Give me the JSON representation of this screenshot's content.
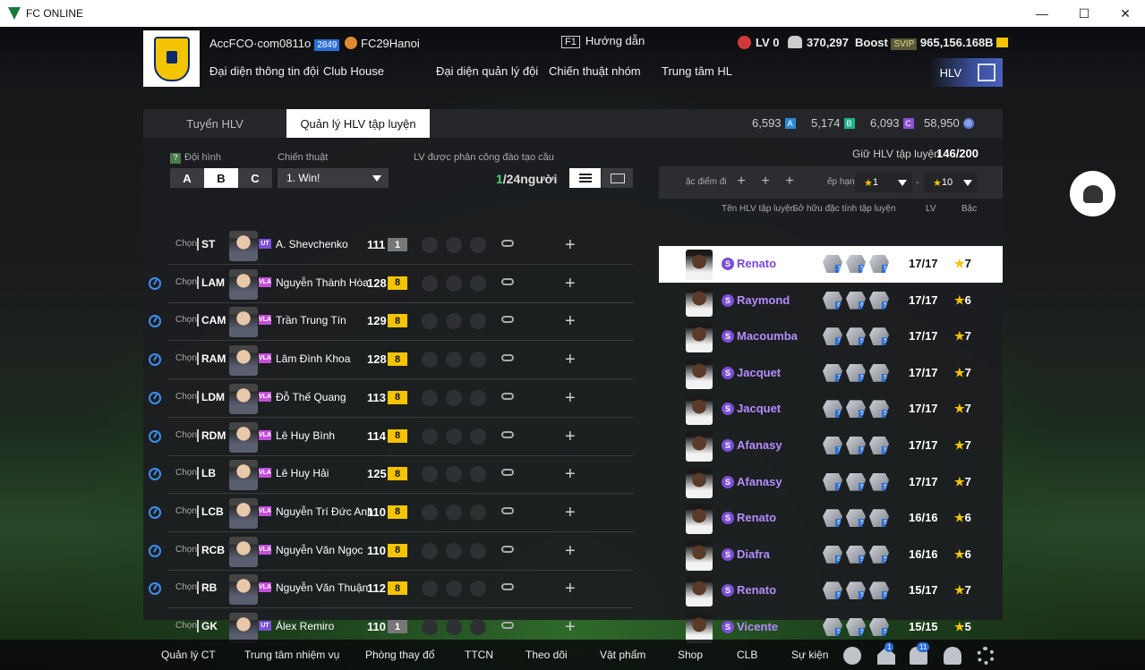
{
  "window": {
    "title": "FC ONLINE",
    "min": "—",
    "max": "☐",
    "close": "✕"
  },
  "header": {
    "account": "AccFCO·com0811o",
    "ovr": "2849",
    "club": "FC29Hanoi",
    "guide_key": "F1",
    "guide": "Hướng dẫn",
    "lv": "LV 0",
    "points": "370,297",
    "boost": "Boost",
    "svip": "SVIP",
    "bp": "965,156.168B",
    "nav": [
      "Đại diện thông tin đội",
      "Club House",
      "Đại diện quản lý đội",
      "Chiến thuật nhóm",
      "Trung tâm HL"
    ],
    "hlv": "HLV"
  },
  "tabs": [
    "Tuyển HLV",
    "Quản lý HLV tập luyện"
  ],
  "currencies": [
    {
      "v": "6,593",
      "g": "A",
      "c": "#2a8ad6"
    },
    {
      "v": "5,174",
      "g": "B",
      "c": "#1fb08a"
    },
    {
      "v": "6,093",
      "g": "C",
      "c": "#8a4fd8"
    },
    {
      "v": "58,950",
      "g": "◎",
      "c": "#5a7ad8"
    }
  ],
  "left": {
    "formation_label": "Đội hình",
    "formation_help": "?",
    "formations": [
      "A",
      "B",
      "C"
    ],
    "selected_formation": "B",
    "tactic_label": "Chiến thuật",
    "tactic_value": "1. Win!",
    "assign_label": "LV được phân công đào tạo cầu thủ",
    "assigned": "1",
    "assign_total": "/24người",
    "players": [
      {
        "pos": "ST",
        "season": "UT",
        "sc": "#7b4fd8",
        "name": "A. Shevchenko",
        "ovr": "111",
        "lvl": "1",
        "timer": false
      },
      {
        "pos": "LAM",
        "season": "VLA",
        "sc": "#c24fd8",
        "name": "Nguyễn Thành Hòa",
        "ovr": "128",
        "lvl": "8",
        "timer": true
      },
      {
        "pos": "CAM",
        "season": "VLA",
        "sc": "#c24fd8",
        "name": "Trần Trung Tín",
        "ovr": "129",
        "lvl": "8",
        "timer": true
      },
      {
        "pos": "RAM",
        "season": "VLA",
        "sc": "#c24fd8",
        "name": "Lâm Đình Khoa",
        "ovr": "128",
        "lvl": "8",
        "timer": true
      },
      {
        "pos": "LDM",
        "season": "VLA",
        "sc": "#c24fd8",
        "name": "Đỗ Thế Quang",
        "ovr": "113",
        "lvl": "8",
        "timer": true
      },
      {
        "pos": "RDM",
        "season": "VLA",
        "sc": "#c24fd8",
        "name": "Lê Huy Bình",
        "ovr": "114",
        "lvl": "8",
        "timer": true
      },
      {
        "pos": "LB",
        "season": "VLA",
        "sc": "#c24fd8",
        "name": "Lê Huy Hải",
        "ovr": "125",
        "lvl": "8",
        "timer": true
      },
      {
        "pos": "LCB",
        "season": "VLA",
        "sc": "#c24fd8",
        "name": "Nguyễn Trí Đức Anh",
        "ovr": "110",
        "lvl": "8",
        "timer": true
      },
      {
        "pos": "RCB",
        "season": "VLA",
        "sc": "#c24fd8",
        "name": "Nguyễn Văn Ngọc",
        "ovr": "110",
        "lvl": "8",
        "timer": true
      },
      {
        "pos": "RB",
        "season": "VLA",
        "sc": "#c24fd8",
        "name": "Nguyễn Văn Thuận",
        "ovr": "112",
        "lvl": "8",
        "timer": true
      },
      {
        "pos": "GK",
        "season": "UT",
        "sc": "#7b4fd8",
        "name": "Álex Remiro",
        "ovr": "110",
        "lvl": "1",
        "timer": false
      }
    ],
    "chon": "Chọn"
  },
  "right": {
    "keep_label": "Giữ HLV tập luyện",
    "keep_value": "146/200",
    "trait_label": "ặc điểm đi",
    "rank_label": "ếp hạng",
    "rank_from": "1",
    "rank_to": "10",
    "col_name": "Tên HLV tập luyện",
    "col_trait": "Sở hữu đặc tính tập luyện",
    "col_lv": "LV",
    "col_grade": "Bậc",
    "coaches": [
      {
        "name": "Renato",
        "t": [
          "7",
          "5",
          "5"
        ],
        "lv": "17/17",
        "grade": "7"
      },
      {
        "name": "Raymond",
        "t": [
          "6",
          "6",
          "5"
        ],
        "lv": "17/17",
        "grade": "6"
      },
      {
        "name": "Macoumba",
        "t": [
          "7",
          "5",
          "5"
        ],
        "lv": "17/17",
        "grade": "7"
      },
      {
        "name": "Jacquet",
        "t": [
          "7",
          "5",
          "5"
        ],
        "lv": "17/17",
        "grade": "7"
      },
      {
        "name": "Jacquet",
        "t": [
          "7",
          "5",
          "5"
        ],
        "lv": "17/17",
        "grade": "7"
      },
      {
        "name": "Afanasy",
        "t": [
          "7",
          "5",
          "5"
        ],
        "lv": "17/17",
        "grade": "7"
      },
      {
        "name": "Afanasy",
        "t": [
          "7",
          "5",
          "5"
        ],
        "lv": "17/17",
        "grade": "7"
      },
      {
        "name": "Renato",
        "t": [
          "6",
          "5",
          "5"
        ],
        "lv": "16/16",
        "grade": "6"
      },
      {
        "name": "Diafra",
        "t": [
          "6",
          "5",
          "5"
        ],
        "lv": "16/16",
        "grade": "6"
      },
      {
        "name": "Renato",
        "t": [
          "5",
          "5",
          "5"
        ],
        "lv": "15/17",
        "grade": "7"
      },
      {
        "name": "Vicente",
        "t": [
          "5",
          "5",
          "5"
        ],
        "lv": "15/15",
        "grade": "5"
      }
    ]
  },
  "bottom": {
    "items": [
      "Quản lý CT",
      "Trung tâm nhiệm vụ",
      "Phòng thay đổ",
      "TTCN",
      "Theo dõi",
      "Vật phẩm",
      "Shop",
      "CLB",
      "Sự kiện"
    ],
    "home_badge": "1",
    "bell_badge": "11"
  },
  "colors": {
    "accent": "#2a6fd6",
    "level_gold": "#f5c400",
    "coach_name": "#b48cff"
  }
}
